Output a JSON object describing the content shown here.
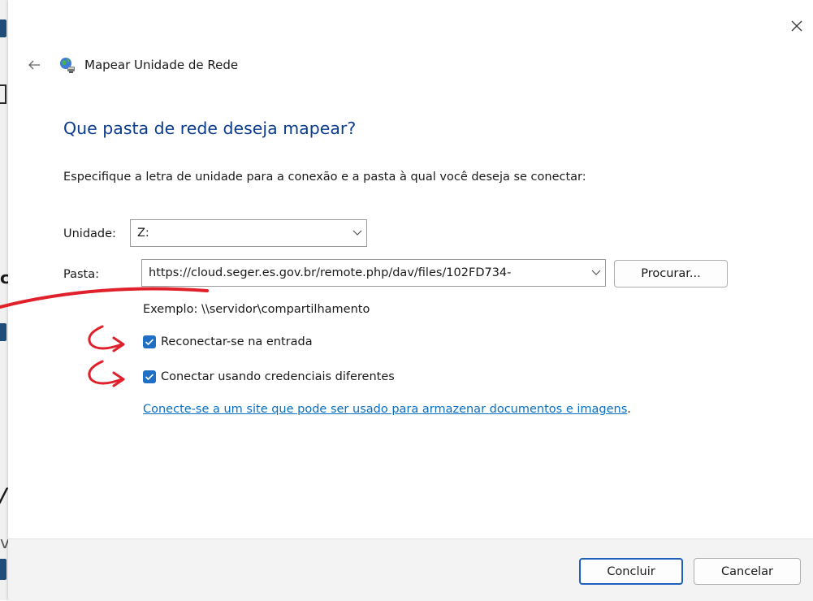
{
  "background_fragments": {
    "frag_c": "c",
    "frag_slash": "/",
    "frag_v": "v"
  },
  "dialog": {
    "title": "Mapear Unidade de Rede",
    "heading": "Que pasta de rede deseja mapear?",
    "instruction": "Especifique a letra de unidade para a conexão e a pasta à qual você deseja se conectar:",
    "drive_label": "Unidade:",
    "drive_value": "Z:",
    "folder_label": "Pasta:",
    "folder_value": "https://cloud.seger.es.gov.br/remote.php/dav/files/102FD734-",
    "browse_label": "Procurar...",
    "example": "Exemplo: \\\\servidor\\compartilhamento",
    "reconnect_label": "Reconectar-se na entrada",
    "reconnect_checked": true,
    "credentials_label": "Conectar usando credenciais diferentes",
    "credentials_checked": true,
    "link_text": "Conecte-se a um site que pode ser usado para armazenar documentos e imagens",
    "link_suffix": ".",
    "finish_label": "Concluir",
    "cancel_label": "Cancelar"
  },
  "icons": {
    "close": "close-icon",
    "back": "back-arrow-icon",
    "network": "network-drive-icon",
    "chevron": "chevron-down-icon",
    "check": "checkmark-icon"
  },
  "colors": {
    "heading": "#0b3b8c",
    "link": "#0a6fc2",
    "checkbox": "#1f6fc5",
    "primary_border": "#1f5fbf",
    "annotation": "#e0202a"
  }
}
